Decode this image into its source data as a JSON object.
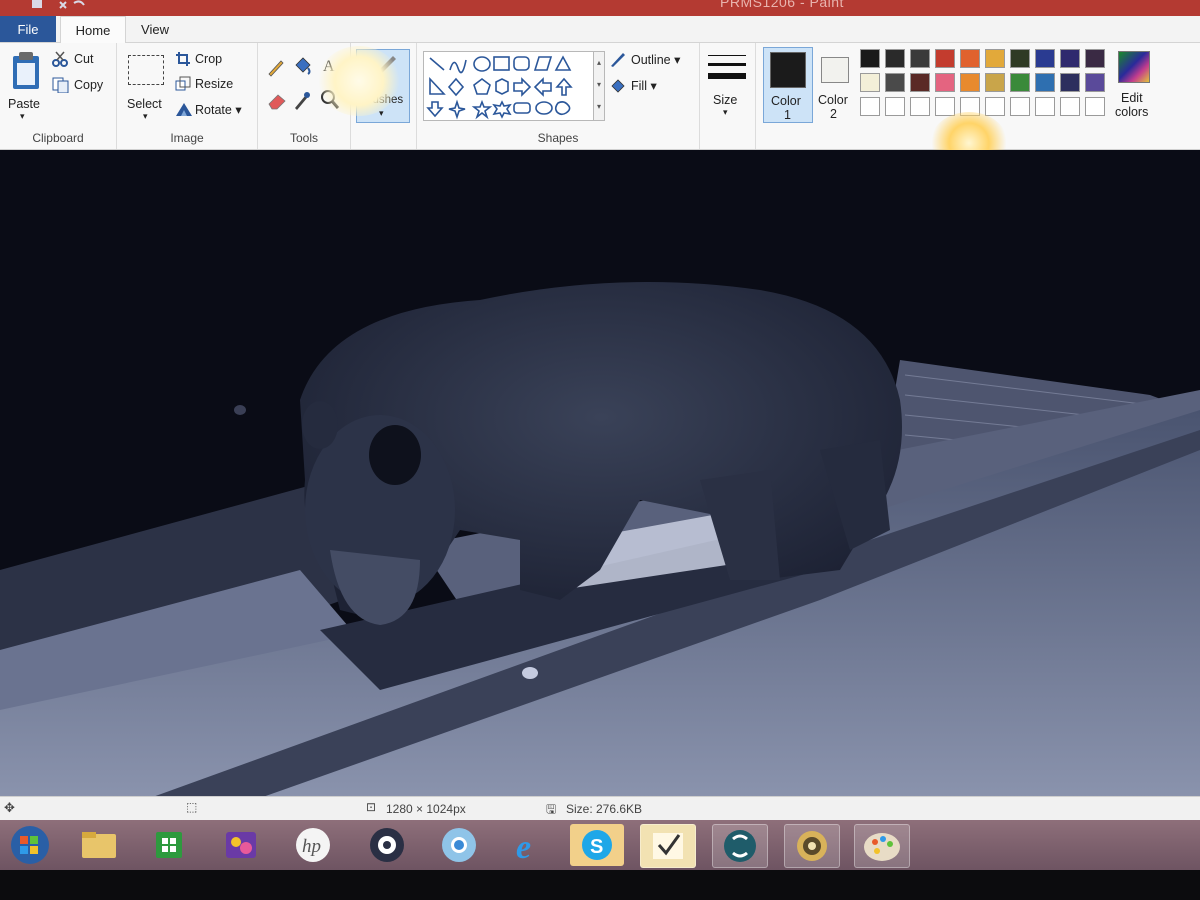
{
  "window": {
    "title": "PRMS1206 - Paint"
  },
  "tabs": [
    {
      "label": "File"
    },
    {
      "label": "Home"
    },
    {
      "label": "View"
    }
  ],
  "clipboard": {
    "paste": "Paste",
    "cut": "Cut",
    "copy": "Copy",
    "group": "Clipboard"
  },
  "image": {
    "select": "Select",
    "crop": "Crop",
    "resize": "Resize",
    "rotate": "Rotate",
    "group": "Image"
  },
  "tools": {
    "group": "Tools"
  },
  "brushes": {
    "label": "Brushes"
  },
  "shapes": {
    "outline": "Outline",
    "fill": "Fill",
    "group": "Shapes"
  },
  "size": {
    "label": "Size"
  },
  "colors": {
    "color1": "Color",
    "color1_num": "1",
    "color2": "Color",
    "color2_num": "2",
    "edit": "Edit",
    "edit2": "colors",
    "active_color": "#1b1b1b",
    "secondary_color": "#f2f2ee",
    "palette": [
      "#1a1a1a",
      "#2a2a2a",
      "#3a3a3a",
      "#c33c2e",
      "#e0622e",
      "#e2a93a",
      "#2f3a24",
      "#2a3b91",
      "#2f2a6e",
      "#3a2a44",
      "#f3efd8",
      "#4a4a4a",
      "#5a2a26",
      "#e46480",
      "#e88a2e",
      "#c9a54a",
      "#3a8a3a",
      "#2e6fb0",
      "#2d2f5e",
      "#5a4a9a"
    ]
  },
  "status": {
    "dimensions": "1280 × 1024px",
    "size": "Size: 276.6KB"
  },
  "taskbar": {
    "apps": [
      "start-orb",
      "file-explorer",
      "store",
      "photo-app",
      "hp",
      "camera-app",
      "chrome",
      "internet-explorer",
      "skype",
      "checkmark-app",
      "sync-app",
      "gold-app",
      "paint"
    ]
  }
}
